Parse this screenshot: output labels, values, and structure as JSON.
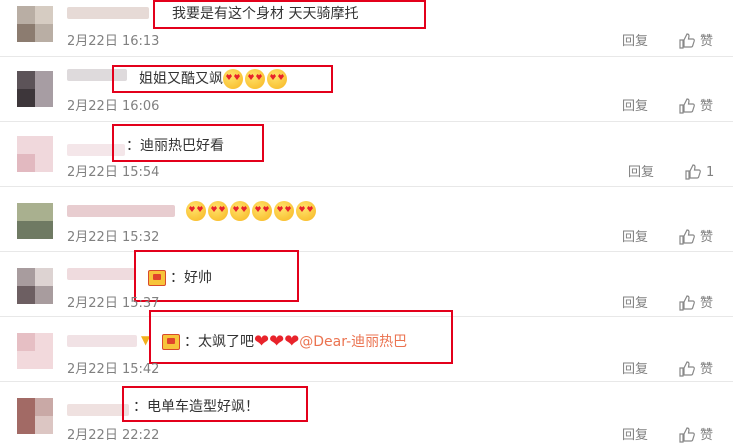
{
  "comments": [
    {
      "text": "我要是有这个身材  天天骑摩托",
      "time": "2月22日 16:13",
      "reply": "回复",
      "like": "赞"
    },
    {
      "text": "姐姐又酷又飒",
      "time": "2月22日 16:06",
      "reply": "回复",
      "like": "赞"
    },
    {
      "text": "：迪丽热巴好看",
      "time": "2月22日 15:54",
      "reply": "回复",
      "like": "1"
    },
    {
      "text": "",
      "time": "2月22日 15:32",
      "reply": "回复",
      "like": "赞"
    },
    {
      "text": "：好帅",
      "time": "2月22日 15:37",
      "reply": "回复",
      "like": "赞"
    },
    {
      "text": "：太飒了吧",
      "mention": "@Dear-迪丽热巴",
      "time": "2月22日 15:42",
      "reply": "回复",
      "like": "赞"
    },
    {
      "text": "：电单车造型好飒！",
      "time": "2月22日 22:22",
      "reply": "回复",
      "like": "赞"
    }
  ],
  "colors": {
    "highlight_box": "#e3001b",
    "mention": "#eb7350",
    "meta": "#808080"
  },
  "icons": {
    "like": "thumbs-up-icon",
    "heart": "heart-icon",
    "emoji": "heart-eyes-emoji-icon",
    "badge": "fan-badge-icon"
  }
}
